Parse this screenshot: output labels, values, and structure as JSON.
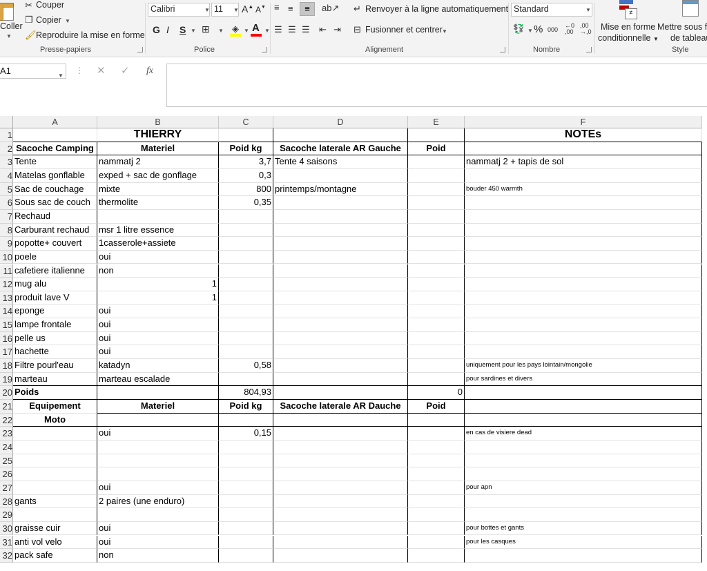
{
  "ribbon": {
    "clipboard": {
      "paste_label": "Coller",
      "cut_label": "Couper",
      "copy_label": "Copier",
      "format_painter_label": "Reproduire la mise en forme",
      "group_label": "Presse-papiers"
    },
    "font": {
      "font_name": "Calibri",
      "font_size": "11",
      "bold_label": "G",
      "italic_label": "I",
      "underline_label": "S",
      "group_label": "Police",
      "font_color": "#ff0000",
      "fill_color": "#ffff00"
    },
    "alignment": {
      "wrap_label": "Renvoyer à la ligne automatiquement",
      "merge_label": "Fusionner et centrer",
      "group_label": "Alignement"
    },
    "number": {
      "format_value": "Standard",
      "percent_label": "%",
      "thousands_label": "000",
      "group_label": "Nombre"
    },
    "styles": {
      "conditional_label_1": "Mise en forme",
      "conditional_label_2": "conditionnelle",
      "table_label_1": "Mettre sous f",
      "table_label_2": "de tableau",
      "group_label": "Style"
    }
  },
  "formula_bar": {
    "name_box": "A1",
    "fx_label": "fx",
    "formula": ""
  },
  "columns": [
    "A",
    "B",
    "C",
    "D",
    "E",
    "F"
  ],
  "rows": [
    {
      "n": "1",
      "A": "",
      "B": "THIERRY",
      "C": "",
      "D": "",
      "E": "",
      "F": "NOTEs"
    },
    {
      "n": "2",
      "A": "Sacoche Camping",
      "B": "Materiel",
      "C": "Poid kg",
      "D": "Sacoche  laterale AR Gauche",
      "E": "Poid",
      "F": ""
    },
    {
      "n": "3",
      "A": "Tente",
      "B": "nammatj 2",
      "C": "3,7",
      "D": "Tente  4 saisons",
      "E": "",
      "F": "nammatj 2 + tapis de sol"
    },
    {
      "n": "4",
      "A": "Matelas gonflable",
      "B": "exped + sac de gonflage",
      "C": "0,3",
      "D": "",
      "E": "",
      "F": ""
    },
    {
      "n": "5",
      "A": "Sac de couchage",
      "B": "mixte",
      "C": "800",
      "D": "printemps/montagne",
      "E": "",
      "F": "bouder 450 warmth"
    },
    {
      "n": "6",
      "A": "Sous sac de couch",
      "B": "thermolite",
      "C": "0,35",
      "D": "",
      "E": "",
      "F": ""
    },
    {
      "n": "7",
      "A": "Rechaud",
      "B": "",
      "C": "",
      "D": "",
      "E": "",
      "F": ""
    },
    {
      "n": "8",
      "A": "Carburant rechaud",
      "B": "msr 1 litre essence",
      "C": "",
      "D": "",
      "E": "",
      "F": ""
    },
    {
      "n": "9",
      "A": "popotte+ couvert",
      "B": "1casserole+assiete",
      "C": "",
      "D": "",
      "E": "",
      "F": ""
    },
    {
      "n": "10",
      "A": "poele",
      "B": "oui",
      "C": "",
      "D": "",
      "E": "",
      "F": ""
    },
    {
      "n": "11",
      "A": "cafetiere italienne",
      "B": "non",
      "C": "",
      "D": "",
      "E": "",
      "F": ""
    },
    {
      "n": "12",
      "A": "mug alu",
      "B": "1",
      "C": "",
      "D": "",
      "E": "",
      "F": ""
    },
    {
      "n": "13",
      "A": "produit lave V",
      "B": "1",
      "C": "",
      "D": "",
      "E": "",
      "F": ""
    },
    {
      "n": "14",
      "A": "eponge",
      "B": "oui",
      "C": "",
      "D": "",
      "E": "",
      "F": ""
    },
    {
      "n": "15",
      "A": "lampe frontale",
      "B": "oui",
      "C": "",
      "D": "",
      "E": "",
      "F": ""
    },
    {
      "n": "16",
      "A": "pelle us",
      "B": "oui",
      "C": "",
      "D": "",
      "E": "",
      "F": ""
    },
    {
      "n": "17",
      "A": "hachette",
      "B": "oui",
      "C": "",
      "D": "",
      "E": "",
      "F": ""
    },
    {
      "n": "18",
      "A": "Filtre pourl'eau",
      "B": "katadyn",
      "C": "0,58",
      "D": "",
      "E": "",
      "F": "uniquement pour les pays lointain/mongolie"
    },
    {
      "n": "19",
      "A": "marteau",
      "B": "marteau escalade",
      "C": "",
      "D": "",
      "E": "",
      "F": "pour sardines et divers"
    },
    {
      "n": "20",
      "A": "Poids",
      "B": "",
      "C": "804,93",
      "D": "",
      "E": "0",
      "F": ""
    },
    {
      "n": "21",
      "A": "Equipement",
      "B": "Materiel",
      "C": "Poid kg",
      "D": "Sacoche  laterale AR Dauche",
      "E": "Poid",
      "F": ""
    },
    {
      "n": "22",
      "A": "Moto",
      "B": "",
      "C": "",
      "D": "",
      "E": "",
      "F": ""
    },
    {
      "n": "23",
      "A": "",
      "B": "oui",
      "C": "0,15",
      "D": "",
      "E": "",
      "F": "en cas de visiere dead"
    },
    {
      "n": "24",
      "A": "",
      "B": "",
      "C": "",
      "D": "",
      "E": "",
      "F": ""
    },
    {
      "n": "25",
      "A": "",
      "B": "",
      "C": "",
      "D": "",
      "E": "",
      "F": ""
    },
    {
      "n": "26",
      "A": "",
      "B": "",
      "C": "",
      "D": "",
      "E": "",
      "F": ""
    },
    {
      "n": "27",
      "A": "",
      "B": "oui",
      "C": "",
      "D": "",
      "E": "",
      "F": "pour apn"
    },
    {
      "n": "28",
      "A": "gants",
      "B": "2 paires (une enduro)",
      "C": "",
      "D": "",
      "E": "",
      "F": ""
    },
    {
      "n": "29",
      "A": "",
      "B": "",
      "C": "",
      "D": "",
      "E": "",
      "F": ""
    },
    {
      "n": "30",
      "A": "graisse cuir",
      "B": "oui",
      "C": "",
      "D": "",
      "E": "",
      "F": "pour bottes et gants"
    },
    {
      "n": "31",
      "A": "anti vol velo",
      "B": "oui",
      "C": "",
      "D": "",
      "E": "",
      "F": "pour les casques"
    },
    {
      "n": "32",
      "A": "pack safe",
      "B": "non",
      "C": "",
      "D": "",
      "E": "",
      "F": ""
    }
  ]
}
